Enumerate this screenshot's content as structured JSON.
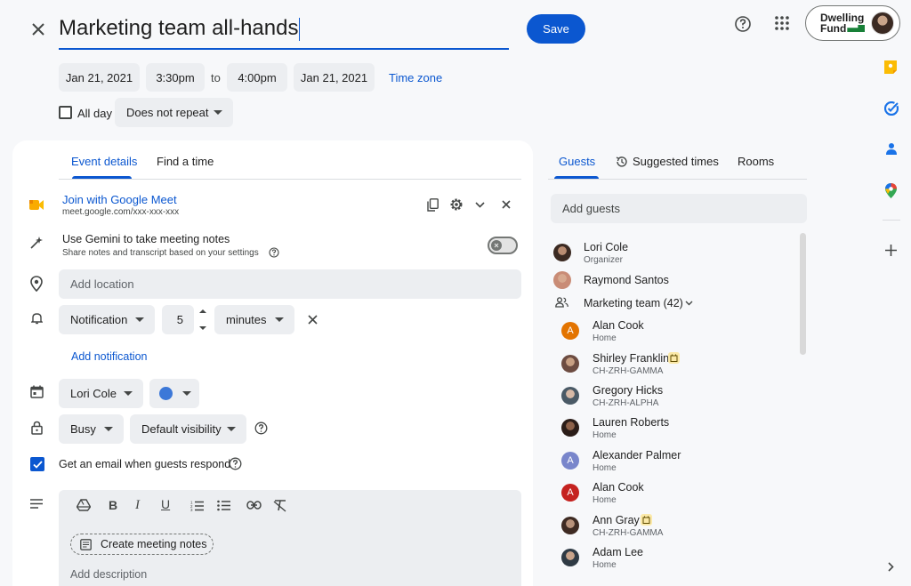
{
  "header": {
    "title": "Marketing team all-hands",
    "save_label": "Save",
    "logo": {
      "line1": "Dwelling",
      "line2": "Fund"
    }
  },
  "datetime": {
    "start_date": "Jan 21, 2021",
    "start_time": "3:30pm",
    "to_label": "to",
    "end_time": "4:00pm",
    "end_date": "Jan 21, 2021",
    "timezone_label": "Time zone",
    "allday_label": "All day",
    "repeat_value": "Does not repeat"
  },
  "left_tabs": [
    "Event details",
    "Find a time"
  ],
  "meet": {
    "join_label": "Join with Google Meet",
    "link": "meet.google.com/xxx-xxx-xxx"
  },
  "gemini": {
    "title": "Use Gemini to take meeting notes",
    "subtitle": "Share notes and transcript based on your settings"
  },
  "location_placeholder": "Add location",
  "notification": {
    "type": "Notification",
    "amount": "5",
    "unit": "minutes",
    "add_label": "Add notification"
  },
  "calendar": {
    "owner": "Lori Cole",
    "color": "#3c78d8"
  },
  "availability": {
    "status": "Busy",
    "visibility": "Default visibility"
  },
  "email_option": {
    "label": "Get an email when guests respond",
    "checked": true
  },
  "description": {
    "notes_button": "Create meeting notes",
    "placeholder": "Add description"
  },
  "right_tabs": [
    "Guests",
    "Suggested times",
    "Rooms"
  ],
  "guests": {
    "add_placeholder": "Add guests",
    "organizer": {
      "name": "Lori Cole",
      "role": "Organizer"
    },
    "second": {
      "name": "Raymond Santos"
    },
    "group": {
      "label": "Marketing team (42)"
    },
    "members": [
      {
        "name": "Alan Cook",
        "sub": "Home",
        "initial": "A",
        "color": "#e37400"
      },
      {
        "name": "Shirley Franklin",
        "sub": "CH-ZRH-GAMMA",
        "initial": "",
        "color": "#8d6e63"
      },
      {
        "name": "Gregory Hicks",
        "sub": "CH-ZRH-ALPHA",
        "initial": "",
        "color": "#607d8b"
      },
      {
        "name": "Lauren Roberts",
        "sub": "Home",
        "initial": "",
        "color": "#5d4037"
      },
      {
        "name": "Alexander Palmer",
        "sub": "Home",
        "initial": "A",
        "color": "#7986cb"
      },
      {
        "name": "Alan Cook",
        "sub": "Home",
        "initial": "A",
        "color": "#c5221f"
      },
      {
        "name": "Ann Gray",
        "sub": "CH-ZRH-GAMMA",
        "initial": "",
        "color": "#6d4c41"
      },
      {
        "name": "Adam Lee",
        "sub": "Home",
        "initial": "",
        "color": "#455a64"
      }
    ]
  },
  "sidebar_icons": [
    "keep-icon",
    "tasks-icon",
    "contacts-icon",
    "maps-icon",
    "add-icon"
  ]
}
